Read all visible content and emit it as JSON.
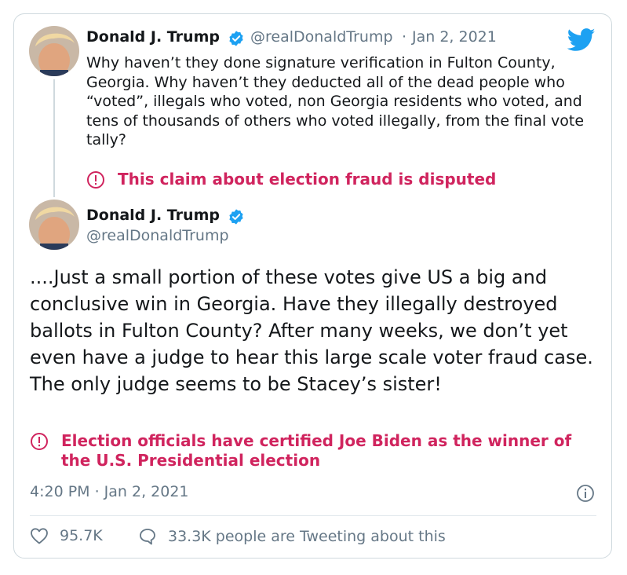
{
  "quoted_tweet": {
    "display_name": "Donald J. Trump",
    "handle": "@realDonaldTrump",
    "separator": "·",
    "date": "Jan 2, 2021",
    "text": "Why haven’t they done signature verification in Fulton County, Georgia. Why haven’t they deducted all of the dead people who “voted”, illegals who voted, non Georgia residents who voted, and tens of thousands of others who voted illegally, from the final vote tally?",
    "warning": "This claim about election fraud is disputed"
  },
  "main_tweet": {
    "display_name": "Donald J. Trump",
    "handle": "@realDonaldTrump",
    "text": "....Just a small portion of these votes give US a big and conclusive win in Georgia. Have they illegally destroyed ballots in Fulton County? After many weeks, we don’t yet even have a judge to hear this large scale voter fraud case. The only judge seems to be Stacey’s sister!",
    "warning": "Election officials have certified Joe Biden as the winner of the U.S. Presidential election",
    "timestamp": "4:20 PM · Jan 2, 2021"
  },
  "stats": {
    "likes": "95.7K",
    "tweeting": "33.3K people are Tweeting about this"
  },
  "icons": {
    "brand": "twitter-bird-icon",
    "verified": "verified-badge-icon",
    "warning": "exclamation-circle-icon",
    "info": "info-icon",
    "like": "heart-icon",
    "reply": "speech-bubble-icon"
  },
  "colors": {
    "twitter_blue": "#1da1f2",
    "warning_red": "#d0245e",
    "secondary_text": "#657786"
  }
}
